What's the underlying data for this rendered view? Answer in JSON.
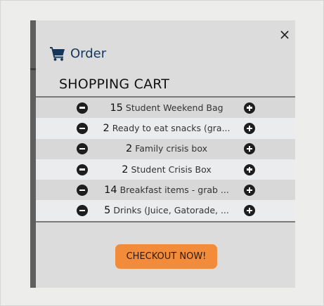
{
  "header": {
    "close_glyph": "×",
    "cart_icon": "shopping-cart-icon",
    "order_label": "Order",
    "title": "SHOPPING CART"
  },
  "cart": {
    "items": [
      {
        "qty": "15",
        "name": "Student Weekend Bag"
      },
      {
        "qty": "2",
        "name": "Ready to eat snacks (gra..."
      },
      {
        "qty": "2",
        "name": "Family crisis box"
      },
      {
        "qty": "2",
        "name": "Student Crisis Box"
      },
      {
        "qty": "14",
        "name": "Breakfast items - grab ..."
      },
      {
        "qty": "5",
        "name": "Drinks (Juice, Gatorade, ..."
      }
    ]
  },
  "checkout": {
    "label": "CHECKOUT NOW!"
  },
  "colors": {
    "accent": "#f28c3a",
    "brand": "#16365a"
  }
}
